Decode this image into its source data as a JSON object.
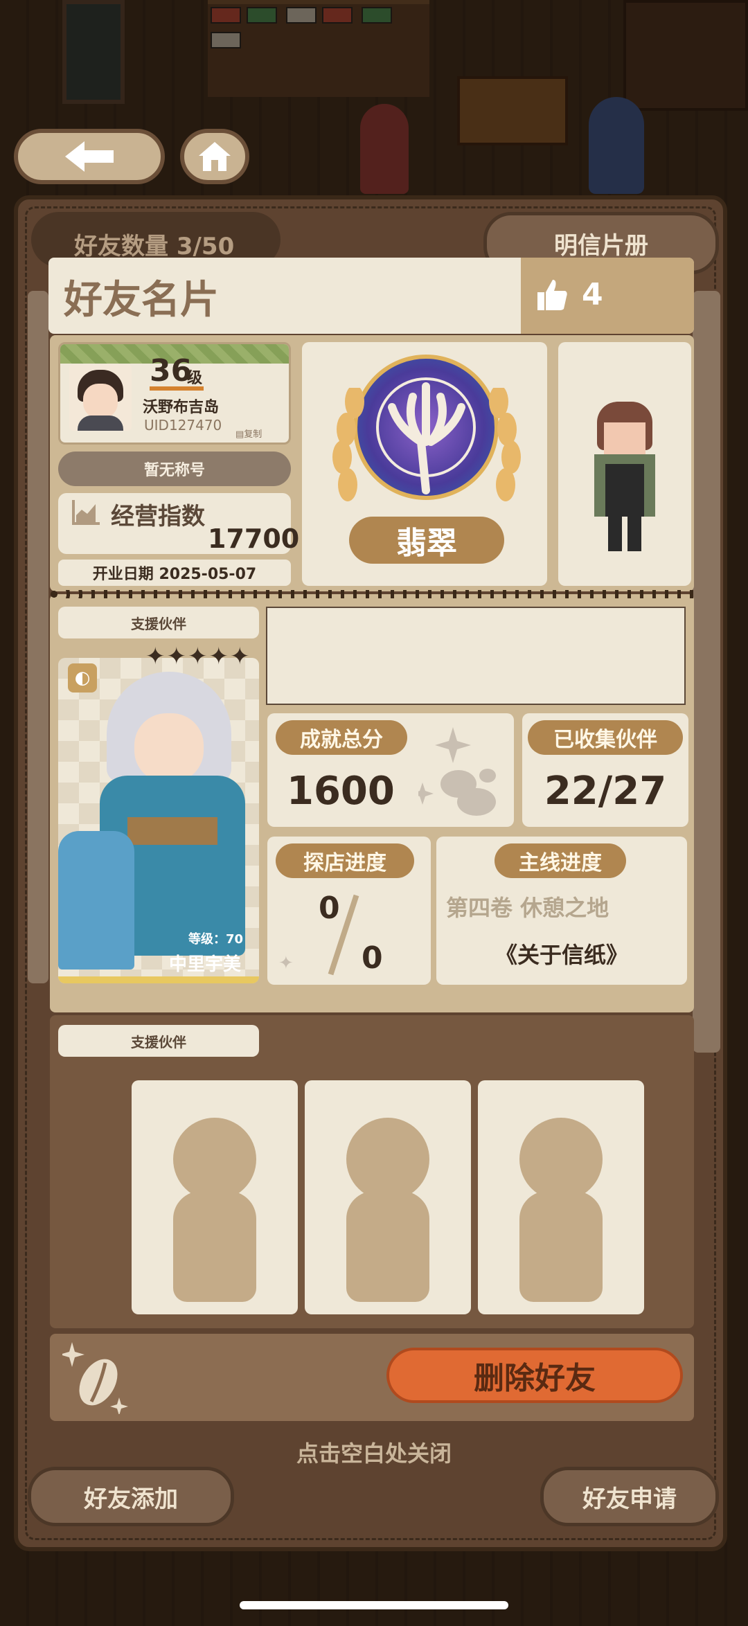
{
  "header": {
    "friend_count_label": "好友数量 3/50",
    "postcard_button": "明信片册",
    "title": "好友名片",
    "likes": "4"
  },
  "profile": {
    "level": "36",
    "level_unit": "级",
    "name": "沃野布吉岛",
    "uid": "UID127470",
    "copy_label": "复制",
    "title_badge": "暂无称号",
    "business_index_label": "经营指数",
    "business_index_value": "17700",
    "open_date": "开业日期 2025-05-07",
    "rank_name": "翡翠"
  },
  "support": {
    "section_label": "支援伙伴",
    "partner_level": "等级：70",
    "partner_name": "中里宇美",
    "stars": "✦✦✦✦✦"
  },
  "stats": {
    "achievement_label": "成就总分",
    "achievement_value": "1600",
    "collected_label": "已收集伙伴",
    "collected_value": "22/27",
    "explore_label": "探店进度",
    "explore_num": "0",
    "explore_den": "0",
    "story_label": "主线进度",
    "story_volume": "第四卷 休憩之地",
    "story_chapter": "《关于信纸》"
  },
  "support2": {
    "section_label": "支援伙伴"
  },
  "actions": {
    "delete_friend": "删除好友",
    "close_hint": "点击空白处关闭",
    "add_friend": "好友添加",
    "friend_request": "好友申请"
  },
  "colors": {
    "accent_orange": "#e06a33",
    "label_brown": "#b08650",
    "card_cream": "#efe8d8"
  }
}
